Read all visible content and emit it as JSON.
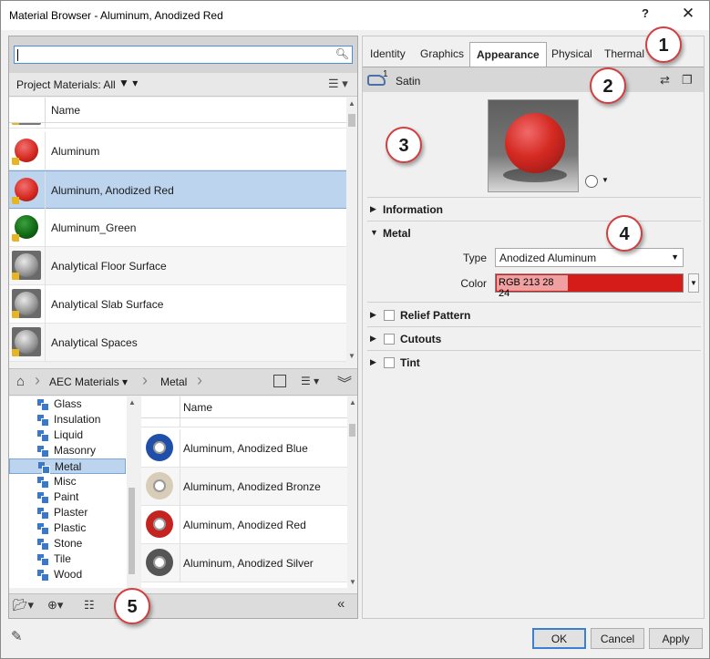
{
  "window": {
    "title": "Material Browser - Aluminum, Anodized Red",
    "help_label": "?",
    "close_label": "✕"
  },
  "search": {
    "value": "",
    "icon": "magnifier-icon"
  },
  "project_bar": {
    "label": "Project Materials: All",
    "filter_symbol": "▼ ▾",
    "view_symbol": "☰ ▾"
  },
  "project_grid": {
    "name_header": "Name",
    "rows": [
      {
        "name": "Aluminum",
        "color": "#d82a22",
        "selected": false
      },
      {
        "name": "Aluminum, Anodized Red",
        "color": "#d82a22",
        "selected": true
      },
      {
        "name": "Aluminum_Green",
        "color": "#116a16",
        "selected": false
      },
      {
        "name": "Analytical Floor Surface",
        "color": "#9a9a9a",
        "selected": false
      },
      {
        "name": "Analytical Slab Surface",
        "color": "#9a9a9a",
        "selected": false
      },
      {
        "name": "Analytical Spaces",
        "color": "#9a9a9a",
        "selected": false
      }
    ]
  },
  "library_bar": {
    "home_icon": "⌂",
    "crumbs": [
      "AEC Materials ▾",
      "Metal"
    ]
  },
  "tree": {
    "items": [
      "Glass",
      "Insulation",
      "Liquid",
      "Masonry",
      "Metal",
      "Misc",
      "Paint",
      "Plaster",
      "Plastic",
      "Stone",
      "Tile",
      "Wood"
    ],
    "selected": "Metal"
  },
  "library_grid": {
    "name_header": "Name",
    "rows": [
      {
        "name": "Aluminum, Anodized Blue",
        "color": "#1f4fa8"
      },
      {
        "name": "Aluminum, Anodized Bronze",
        "color": "#d8cdb8"
      },
      {
        "name": "Aluminum, Anodized Red",
        "color": "#c42420"
      },
      {
        "name": "Aluminum, Anodized Silver",
        "color": "#555555"
      }
    ]
  },
  "tabs": [
    {
      "label": "Identity",
      "active": false
    },
    {
      "label": "Graphics",
      "active": false
    },
    {
      "label": "Appearance",
      "active": true
    },
    {
      "label": "Physical",
      "active": false
    },
    {
      "label": "Thermal",
      "active": false
    }
  ],
  "asset": {
    "count": "1",
    "name": "Satin"
  },
  "sections": {
    "information": "Information",
    "metal": "Metal",
    "relief": "Relief Pattern",
    "cutouts": "Cutouts",
    "tint": "Tint"
  },
  "metal_props": {
    "type_label": "Type",
    "type_value": "Anodized Aluminum",
    "color_label": "Color",
    "color_value": "RGB 213 28 24",
    "color_hex": "#d51c18"
  },
  "buttons": {
    "ok": "OK",
    "cancel": "Cancel",
    "apply": "Apply"
  },
  "callouts": [
    "1",
    "2",
    "3",
    "4",
    "5"
  ]
}
